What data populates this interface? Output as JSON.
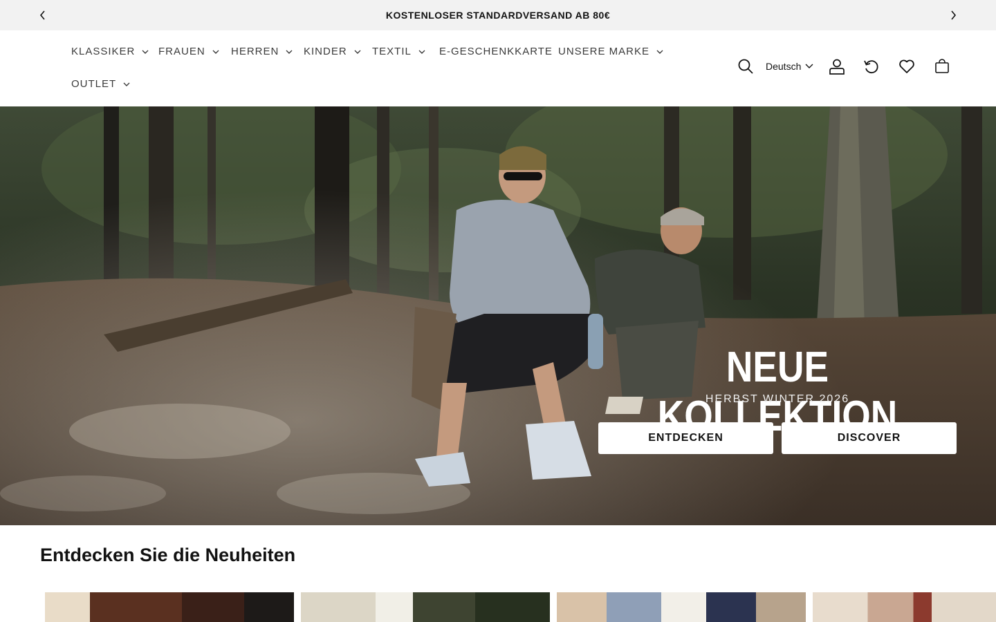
{
  "announcement": {
    "text": "KOSTENLOSER STANDARDVERSAND AB 80€",
    "prev_icon": "chevron-left-icon",
    "next_icon": "chevron-right-icon"
  },
  "nav": {
    "items": [
      {
        "label": "KLASSIKER",
        "has_dropdown": true
      },
      {
        "label": "FRAUEN",
        "has_dropdown": true
      },
      {
        "label": "HERREN",
        "has_dropdown": true
      },
      {
        "label": "KINDER",
        "has_dropdown": true
      },
      {
        "label": "TEXTIL",
        "has_dropdown": true
      },
      {
        "label": "E-GESCHENKKARTE",
        "has_dropdown": false
      },
      {
        "label": "UNSERE MARKE",
        "has_dropdown": true
      },
      {
        "label": "OUTLET",
        "has_dropdown": true
      }
    ]
  },
  "utilities": {
    "search_icon": "search-icon",
    "language": "Deutsch",
    "account_icon": "user-icon",
    "returns_icon": "return-icon",
    "wishlist_icon": "heart-icon",
    "cart_icon": "cart-icon"
  },
  "hero": {
    "title": "NEUE KOLLEKTION",
    "subtitle": "HERBST WINTER 2026",
    "button_primary": "ENTDECKEN",
    "button_secondary": "DISCOVER"
  },
  "section": {
    "title": "Entdecken Sie die Neuheiten"
  },
  "colors": {
    "announcement_bg": "#f2f2f2",
    "text": "#121212",
    "nav_text": "#3a3a3a",
    "button_bg": "#ffffff"
  }
}
